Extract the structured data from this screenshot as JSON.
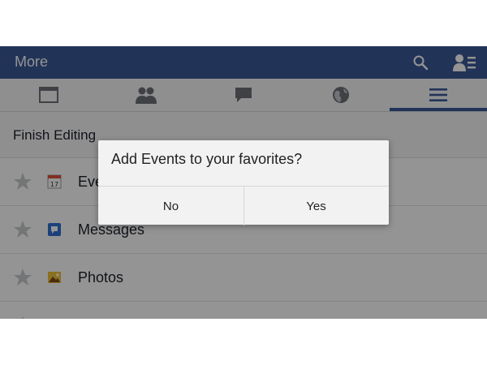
{
  "topbar": {
    "title": "More",
    "icons": [
      "search-icon",
      "people-icon"
    ]
  },
  "tabs": [
    {
      "name": "news-feed",
      "icon": "newsfeed-icon"
    },
    {
      "name": "friend-requests",
      "icon": "friends-icon"
    },
    {
      "name": "messages",
      "icon": "chat-icon"
    },
    {
      "name": "notifications",
      "icon": "globe-icon"
    },
    {
      "name": "more",
      "icon": "menu-icon",
      "active": true
    }
  ],
  "section": {
    "label": "Finish Editing"
  },
  "items": [
    {
      "label": "Events",
      "icon": "calendar-icon",
      "calendar_day": "17"
    },
    {
      "label": "Messages",
      "icon": "messages-icon"
    },
    {
      "label": "Photos",
      "icon": "photos-icon"
    }
  ],
  "dialog": {
    "question": "Add Events to your favorites?",
    "no_label": "No",
    "yes_label": "Yes"
  },
  "colors": {
    "brand": "#3b5998",
    "overlay": "rgba(0,0,0,0.42)",
    "star": "#c9cacc"
  }
}
